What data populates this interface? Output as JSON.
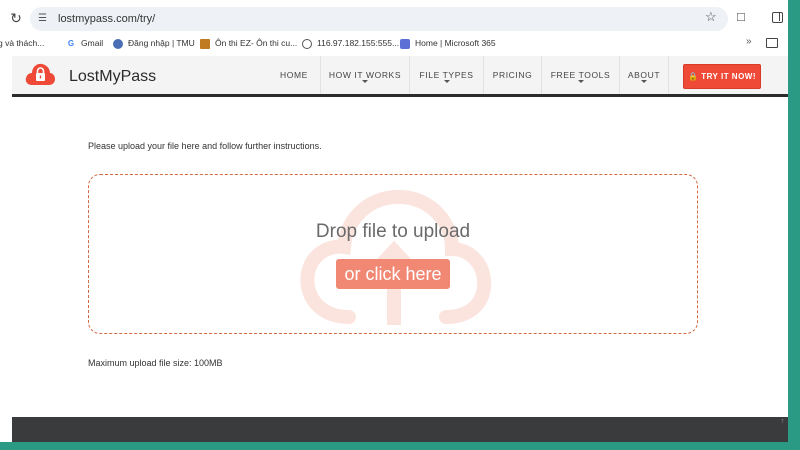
{
  "browser": {
    "url": "lostmypass.com/try/",
    "bookmarks": [
      {
        "label": "g và thách...",
        "icon": "globe-icon"
      },
      {
        "label": "Gmail",
        "icon": "google-icon"
      },
      {
        "label": "Đăng nhập | TMU",
        "icon": "tmu-icon"
      },
      {
        "label": "Ôn thi EZ- Ôn thi cu...",
        "icon": "ez-icon"
      },
      {
        "label": "116.97.182.155:555...",
        "icon": "globe-icon"
      },
      {
        "label": "Home | Microsoft 365",
        "icon": "microsoft-icon"
      }
    ]
  },
  "site": {
    "logo_text": "LostMyPass",
    "brand_color": "#ee4a37",
    "nav": [
      {
        "label": "HOME",
        "dropdown": false
      },
      {
        "label": "HOW IT WORKS",
        "dropdown": true
      },
      {
        "label": "FILE TYPES",
        "dropdown": true
      },
      {
        "label": "PRICING",
        "dropdown": false
      },
      {
        "label": "FREE TOOLS",
        "dropdown": true
      },
      {
        "label": "ABOUT",
        "dropdown": true
      }
    ],
    "try_button": "TRY IT NOW!"
  },
  "upload": {
    "instructions": "Please upload your file here and follow further instructions.",
    "drop_text": "Drop file to upload",
    "click_text": "or click here",
    "max_size": "Maximum upload file size: 100MB"
  }
}
